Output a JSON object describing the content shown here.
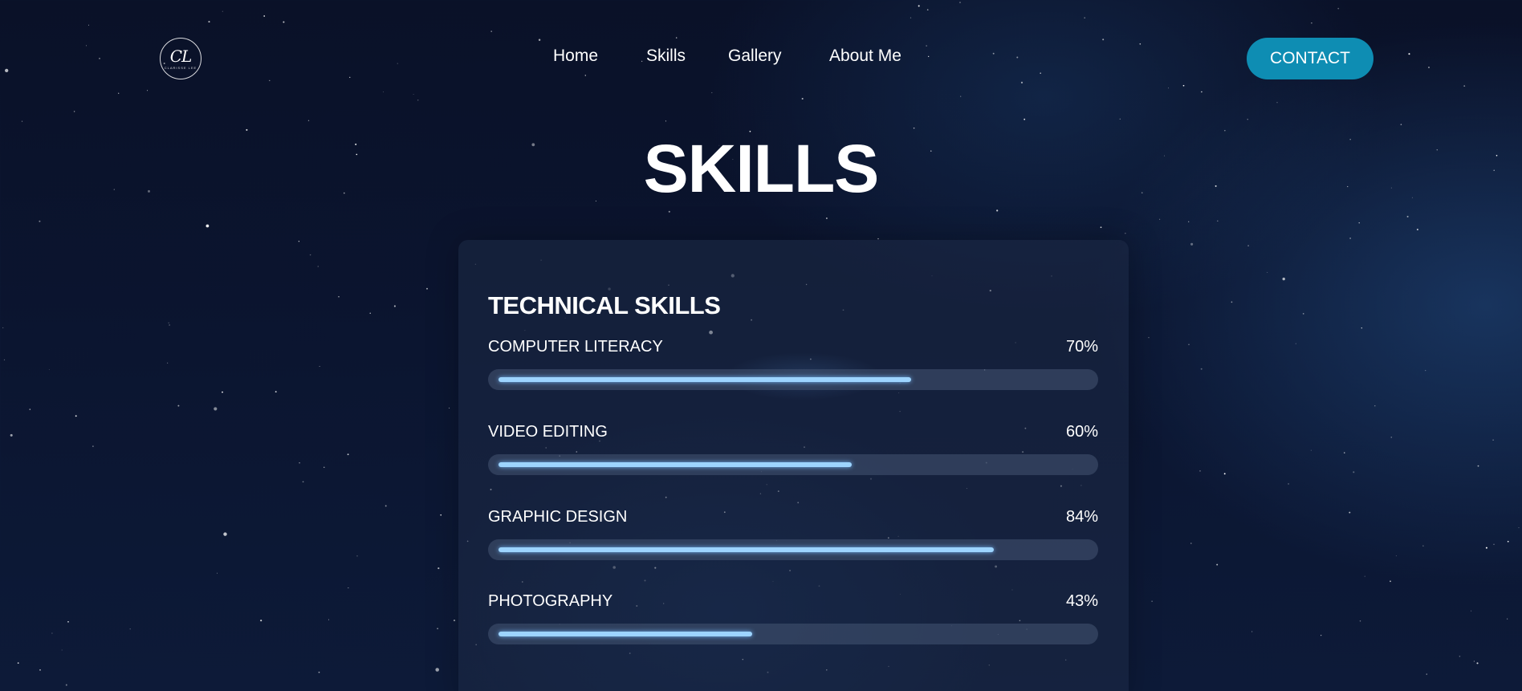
{
  "nav": {
    "logo": {
      "mark": "CL",
      "subtext": "CLARISSE LEE"
    },
    "links": [
      "Home",
      "Skills",
      "Gallery",
      "About Me"
    ],
    "contact_label": "CONTACT"
  },
  "page_title": "SKILLS",
  "technical_skills": {
    "title": "TECHNICAL SKILLS",
    "items": [
      {
        "name": "COMPUTER LITERACY",
        "percent_label": "70%",
        "level": 0.7
      },
      {
        "name": "VIDEO EDITING",
        "percent_label": "60%",
        "level": 0.6
      },
      {
        "name": "GRAPHIC DESIGN",
        "percent_label": "84%",
        "level": 0.84
      },
      {
        "name": "PHOTOGRAPHY",
        "percent_label": "43%",
        "level": 0.43
      }
    ]
  },
  "colors": {
    "accent": "#0e8db3",
    "bar_fill": "#9dd4ff",
    "background": "#0b1530"
  }
}
